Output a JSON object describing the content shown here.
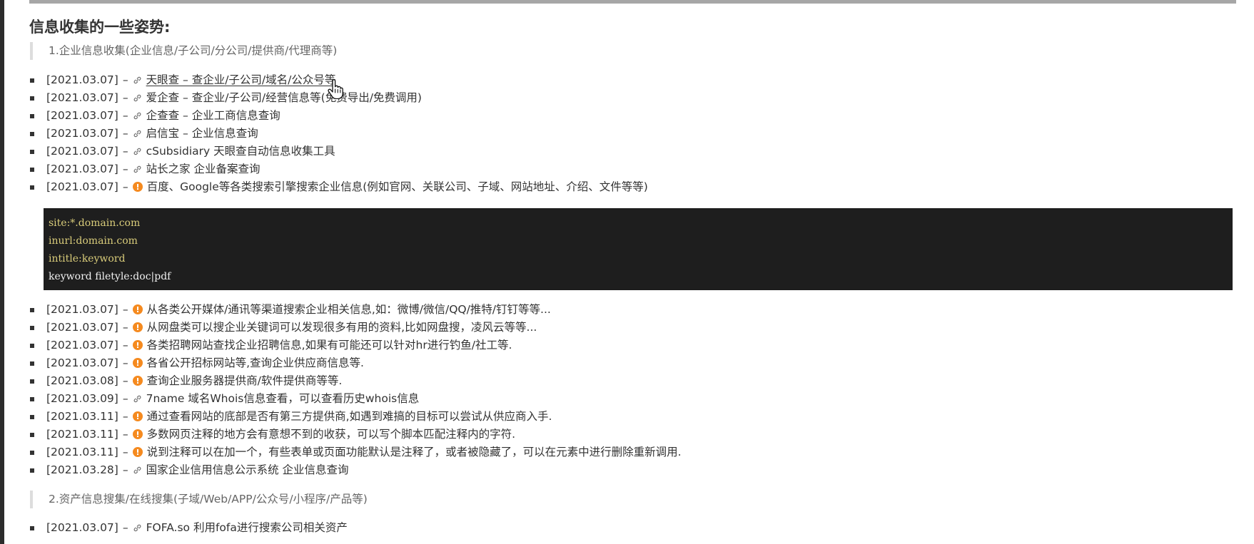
{
  "heading": "信息收集的一些姿势:",
  "sections": [
    {
      "title": "1.企业信息收集(企业信息/子公司/分公司/提供商/代理商等)"
    },
    {
      "title": "2.资产信息搜集/在线搜集(子域/Web/APP/公众号/小程序/产品等)"
    }
  ],
  "list1": [
    {
      "date": "[2021.03.07]",
      "icon": "link-icon",
      "text": "天眼查 – 查企业/子公司/域名/公众号等"
    },
    {
      "date": "[2021.03.07]",
      "icon": "link-icon",
      "text": "爱企查 – 查企业/子公司/经营信息等(免费导出/免费调用)"
    },
    {
      "date": "[2021.03.07]",
      "icon": "link-icon",
      "text": "企查查 – 企业工商信息查询"
    },
    {
      "date": "[2021.03.07]",
      "icon": "link-icon",
      "text": "启信宝 – 企业信息查询"
    },
    {
      "date": "[2021.03.07]",
      "icon": "link-icon",
      "text": "cSubsidiary 天眼查自动信息收集工具"
    },
    {
      "date": "[2021.03.07]",
      "icon": "link-icon",
      "text": "站长之家 企业备案查询"
    },
    {
      "date": "[2021.03.07]",
      "icon": "alert-icon",
      "text": "百度、Google等各类搜索引擎搜索企业信息(例如官网、关联公司、子域、网站地址、介绍、文件等等)"
    }
  ],
  "code_lines": [
    "site:*.domain.com",
    "inurl:domain.com",
    "intitle:keyword",
    "keyword filetyle:doc|pdf"
  ],
  "list2": [
    {
      "date": "[2021.03.07]",
      "icon": "alert-icon",
      "text": "从各类公开媒体/通讯等渠道搜索企业相关信息,如：微博/微信/QQ/推特/钉钉等等..."
    },
    {
      "date": "[2021.03.07]",
      "icon": "alert-icon",
      "text": "从网盘类可以搜企业关键词可以发现很多有用的资料,比如网盘搜，凌风云等等..."
    },
    {
      "date": "[2021.03.07]",
      "icon": "alert-icon",
      "text": "各类招聘网站查找企业招聘信息,如果有可能还可以针对hr进行钓鱼/社工等."
    },
    {
      "date": "[2021.03.07]",
      "icon": "alert-icon",
      "text": "各省公开招标网站等,查询企业供应商信息等."
    },
    {
      "date": "[2021.03.08]",
      "icon": "alert-icon",
      "text": "查询企业服务器提供商/软件提供商等等."
    },
    {
      "date": "[2021.03.09]",
      "icon": "link-icon",
      "text": "7name 域名Whois信息查看，可以查看历史whois信息"
    },
    {
      "date": "[2021.03.11]",
      "icon": "alert-icon",
      "text": "通过查看网站的底部是否有第三方提供商,如遇到难搞的目标可以尝试从供应商入手."
    },
    {
      "date": "[2021.03.11]",
      "icon": "alert-icon",
      "text": "多数网页注释的地方会有意想不到的收获，可以写个脚本匹配注释内的字符."
    },
    {
      "date": "[2021.03.11]",
      "icon": "alert-icon",
      "text": "说到注释可以在加一个，有些表单或页面功能默认是注释了，或者被隐藏了，可以在元素中进行删除重新调用."
    },
    {
      "date": "[2021.03.28]",
      "icon": "link-icon",
      "text": "国家企业信用信息公示系统 企业信息查询"
    }
  ],
  "list3": [
    {
      "date": "[2021.03.07]",
      "icon": "link-icon",
      "text": "FOFA.so 利用fofa进行搜索公司相关资产"
    }
  ],
  "separator": "–",
  "colors": {
    "alert_orange": "#f58a1f",
    "code_background": "#1e1e1e",
    "code_keyword": "#d9cc7a"
  }
}
